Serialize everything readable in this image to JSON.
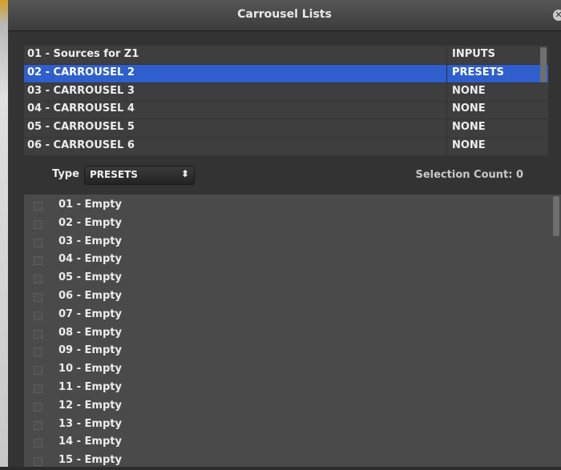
{
  "window": {
    "title": "Carrousel Lists"
  },
  "carousels": [
    {
      "name": "01 - Sources for Z1",
      "type": "INPUTS",
      "selected": false
    },
    {
      "name": "02 - CARROUSEL 2",
      "type": "PRESETS",
      "selected": true
    },
    {
      "name": "03 - CARROUSEL 3",
      "type": "NONE",
      "selected": false
    },
    {
      "name": "04 - CARROUSEL 4",
      "type": "NONE",
      "selected": false
    },
    {
      "name": "05 - CARROUSEL 5",
      "type": "NONE",
      "selected": false
    },
    {
      "name": "06 - CARROUSEL 6",
      "type": "NONE",
      "selected": false
    }
  ],
  "type_filter": {
    "label": "Type",
    "value": "PRESETS"
  },
  "selection_count": "Selection Count: 0",
  "items": [
    {
      "label": "01 - Empty",
      "checked": false
    },
    {
      "label": "02 - Empty",
      "checked": false
    },
    {
      "label": "03 - Empty",
      "checked": false
    },
    {
      "label": "04 - Empty",
      "checked": false
    },
    {
      "label": "05 - Empty",
      "checked": false
    },
    {
      "label": "06 - Empty",
      "checked": false
    },
    {
      "label": "07 - Empty",
      "checked": false
    },
    {
      "label": "08 - Empty",
      "checked": false
    },
    {
      "label": "09 - Empty",
      "checked": false
    },
    {
      "label": "10 - Empty",
      "checked": false
    },
    {
      "label": "11 - Empty",
      "checked": false
    },
    {
      "label": "12 - Empty",
      "checked": false
    },
    {
      "label": "13 - Empty",
      "checked": false
    },
    {
      "label": "14 - Empty",
      "checked": false
    },
    {
      "label": "15 - Empty",
      "checked": false
    }
  ],
  "colors": {
    "selection": "#2e5fcc",
    "panel": "#333333",
    "list": "#4a4a4a"
  }
}
